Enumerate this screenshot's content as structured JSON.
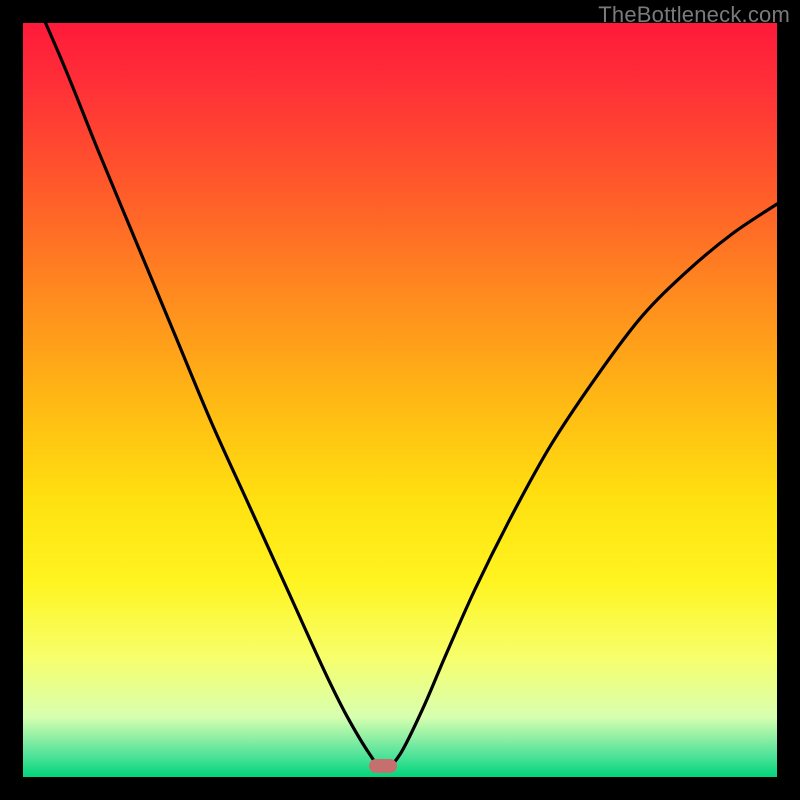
{
  "watermark": "TheBottleneck.com",
  "marker": {
    "cx_frac": 0.478,
    "cy_frac": 0.985
  },
  "chart_data": {
    "type": "line",
    "title": "",
    "xlabel": "",
    "ylabel": "",
    "xlim": [
      0,
      1
    ],
    "ylim": [
      0,
      1
    ],
    "grid": false,
    "legend": false,
    "series": [
      {
        "name": "curve",
        "x": [
          0.03,
          0.06,
          0.1,
          0.15,
          0.2,
          0.25,
          0.3,
          0.35,
          0.4,
          0.43,
          0.46,
          0.478,
          0.5,
          0.53,
          0.56,
          0.6,
          0.65,
          0.7,
          0.76,
          0.82,
          0.88,
          0.94,
          1.0
        ],
        "y": [
          1.0,
          0.93,
          0.83,
          0.71,
          0.59,
          0.47,
          0.36,
          0.25,
          0.14,
          0.08,
          0.03,
          0.01,
          0.03,
          0.09,
          0.16,
          0.25,
          0.35,
          0.44,
          0.53,
          0.61,
          0.67,
          0.72,
          0.76
        ]
      }
    ],
    "background_gradient": {
      "direction": "top-to-bottom",
      "stops": [
        {
          "pos": 0.0,
          "color": "#ff1a3a"
        },
        {
          "pos": 0.5,
          "color": "#ffb814"
        },
        {
          "pos": 0.84,
          "color": "#f7ff6a"
        },
        {
          "pos": 1.0,
          "color": "#00d67a"
        }
      ]
    }
  }
}
